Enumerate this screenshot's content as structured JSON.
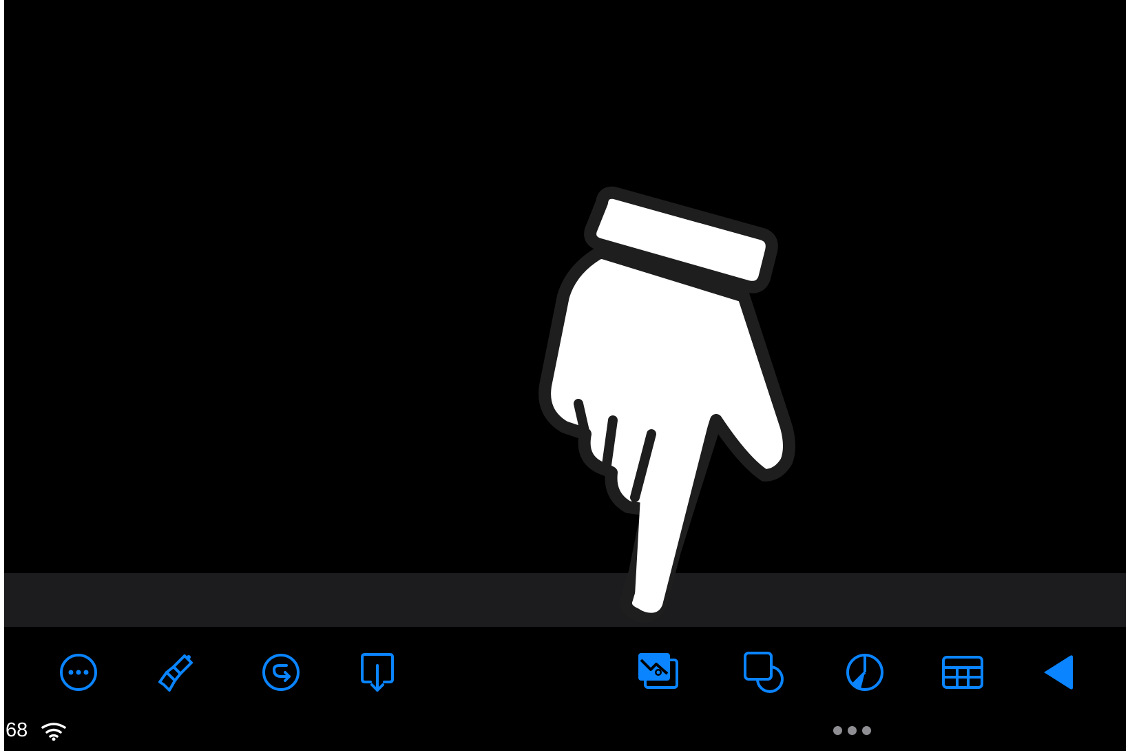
{
  "status": {
    "battery_text": "68",
    "wifi_icon": "wifi-icon",
    "page_dots_icon": "ellipsis-dots-icon"
  },
  "toolbar": {
    "items": [
      {
        "name": "more-options-button",
        "icon": "ellipsis-circle-icon"
      },
      {
        "name": "format-brush-button",
        "icon": "paintbrush-icon"
      },
      {
        "name": "animate-button",
        "icon": "arrow-circle-icon"
      },
      {
        "name": "insert-button",
        "icon": "insert-down-arrow-icon"
      },
      {
        "name": "media-button",
        "icon": "photos-icon"
      },
      {
        "name": "shapes-button",
        "icon": "shapes-icon"
      },
      {
        "name": "chart-button",
        "icon": "pie-chart-icon"
      },
      {
        "name": "table-button",
        "icon": "table-icon"
      },
      {
        "name": "collapse-button",
        "icon": "triangle-left-icon"
      }
    ]
  },
  "colors": {
    "accent": "#0a84ff",
    "background": "#000000",
    "strip": "#1c1c1e",
    "dots": "#8e8e93"
  },
  "overlay": {
    "icon": "pointing-hand-icon"
  }
}
